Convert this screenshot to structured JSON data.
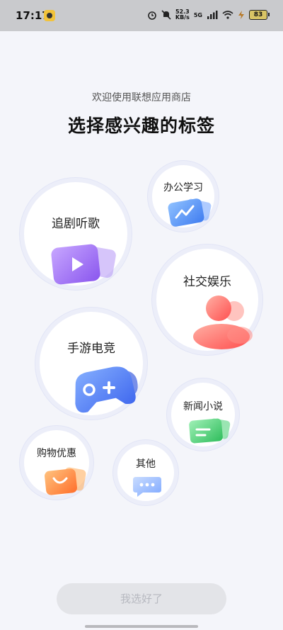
{
  "status_bar": {
    "time": "17:17",
    "net_speed_value": "52.3",
    "net_speed_unit": "KB/s",
    "network_type": "5G",
    "battery": "83"
  },
  "header": {
    "welcome": "欢迎使用联想应用商店",
    "title": "选择感兴趣的标签"
  },
  "tags": {
    "t1": {
      "label": "追剧听歌",
      "icon": "play-video-icon",
      "color": "#9b6cf0"
    },
    "t2": {
      "label": "办公学习",
      "icon": "chart-folder-icon",
      "color": "#4b8df8"
    },
    "t3": {
      "label": "社交娱乐",
      "icon": "user-avatar-icon",
      "color": "#ff6b6b"
    },
    "t4": {
      "label": "手游电竞",
      "icon": "gamepad-icon",
      "color": "#4f7cf6"
    },
    "t5": {
      "label": "新闻小说",
      "icon": "news-book-icon",
      "color": "#39c96a"
    },
    "t6": {
      "label": "购物优惠",
      "icon": "shopping-bag-icon",
      "color": "#ff8a3d"
    },
    "t7": {
      "label": "其他",
      "icon": "chat-more-icon",
      "color": "#8ab2ff"
    }
  },
  "confirm_button": "我选好了"
}
